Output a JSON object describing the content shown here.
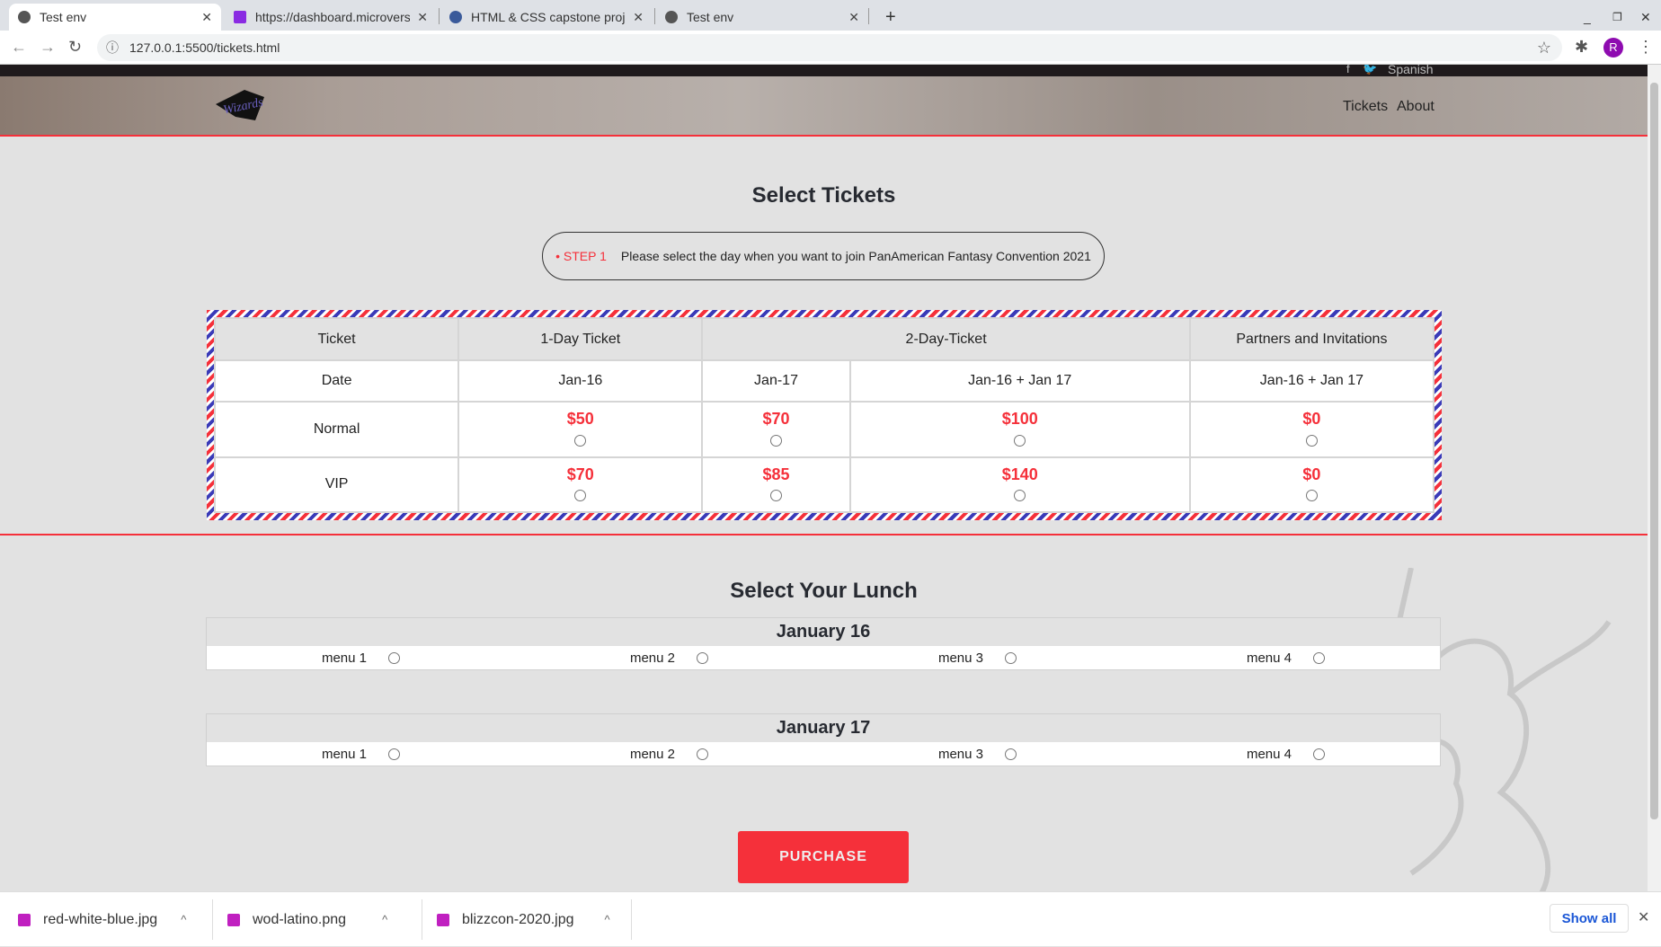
{
  "browser": {
    "tabs": [
      {
        "title": "Test env"
      },
      {
        "title": "https://dashboard.microverse"
      },
      {
        "title": "HTML & CSS capstone project"
      },
      {
        "title": "Test env"
      }
    ],
    "url": "127.0.0.1:5500/tickets.html",
    "profile_initial": "R"
  },
  "header": {
    "language": "Spanish",
    "nav": [
      "Tickets",
      "About"
    ],
    "logo_text": "Wizards"
  },
  "tickets": {
    "title": "Select Tickets",
    "step_label": "• STEP 1",
    "step_text": "Please select the day when you want to join PanAmerican Fantasy Convention 2021",
    "header": [
      "Ticket",
      "1-Day Ticket",
      "2-Day-Ticket",
      "Partners and Invitations"
    ],
    "dates": [
      "Date",
      "Jan-16",
      "Jan-17",
      "Jan-16 + Jan 17",
      "Jan-16 + Jan 17"
    ],
    "rows": [
      {
        "label": "Normal",
        "prices": [
          "$50",
          "$70",
          "$100",
          "$0"
        ]
      },
      {
        "label": "VIP",
        "prices": [
          "$70",
          "$85",
          "$140",
          "$0"
        ]
      }
    ]
  },
  "lunch": {
    "title": "Select Your Lunch",
    "days": [
      {
        "title": "January 16",
        "menus": [
          "menu 1",
          "menu 2",
          "menu 3",
          "menu 4"
        ]
      },
      {
        "title": "January 17",
        "menus": [
          "menu 1",
          "menu 2",
          "menu 3",
          "menu 4"
        ]
      }
    ]
  },
  "purchase_label": "PURCHASE",
  "downloads": {
    "files": [
      "red-white-blue.jpg",
      "wod-latino.png",
      "blizzcon-2020.jpg"
    ],
    "show_all": "Show all"
  },
  "colors": {
    "accent": "#f5303a"
  }
}
